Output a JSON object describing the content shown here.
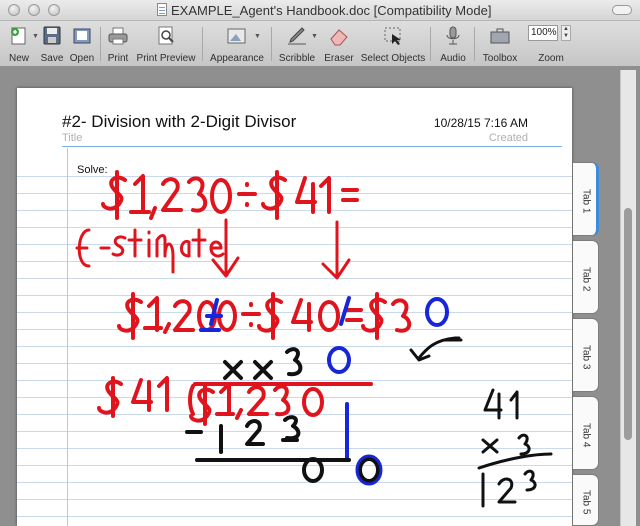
{
  "window": {
    "title": "EXAMPLE_Agent's Handbook.doc [Compatibility Mode]"
  },
  "toolbar": {
    "items": [
      {
        "label": "New",
        "icon": "new-document-icon"
      },
      {
        "label": "Save",
        "icon": "save-icon"
      },
      {
        "label": "Open",
        "icon": "open-icon"
      },
      {
        "label": "Print",
        "icon": "printer-icon"
      },
      {
        "label": "Print Preview",
        "icon": "print-preview-icon"
      },
      {
        "label": "Appearance",
        "icon": "appearance-icon"
      },
      {
        "label": "Scribble",
        "icon": "pen-icon"
      },
      {
        "label": "Eraser",
        "icon": "eraser-icon"
      },
      {
        "label": "Select Objects",
        "icon": "select-objects-icon"
      },
      {
        "label": "Audio",
        "icon": "microphone-icon"
      },
      {
        "label": "Toolbox",
        "icon": "toolbox-icon"
      },
      {
        "label": "Zoom",
        "icon": "zoom-icon"
      }
    ],
    "zoom_value": "100%"
  },
  "note": {
    "title": "#2- Division with 2-Digit Divisor",
    "title_placeholder": "Title",
    "created_value": "10/28/15 7:16 AM",
    "created_label": "Created",
    "body_label": "Solve:"
  },
  "handwriting": {
    "problem": "$1,230 ÷ $41 =",
    "estimate_label": "Estimate",
    "estimate": "$1,200 ÷ $40 = $30",
    "quotient_row": "x x 3 0",
    "long_division": "$41 ) $1,230",
    "subtract_row": "- 1 2 3",
    "remainder_row": "0 0",
    "side_calc": [
      "41",
      "x 3",
      "1 2 3"
    ]
  },
  "tabs": [
    "Tab 1",
    "Tab 2",
    "Tab 3",
    "Tab 4",
    "Tab 5"
  ],
  "colors": {
    "ink_red": "#e0141c",
    "ink_blue": "#1626d8",
    "ink_black": "#111111",
    "ruled_line": "#c9daef",
    "active_tab": "#3a8edb"
  }
}
